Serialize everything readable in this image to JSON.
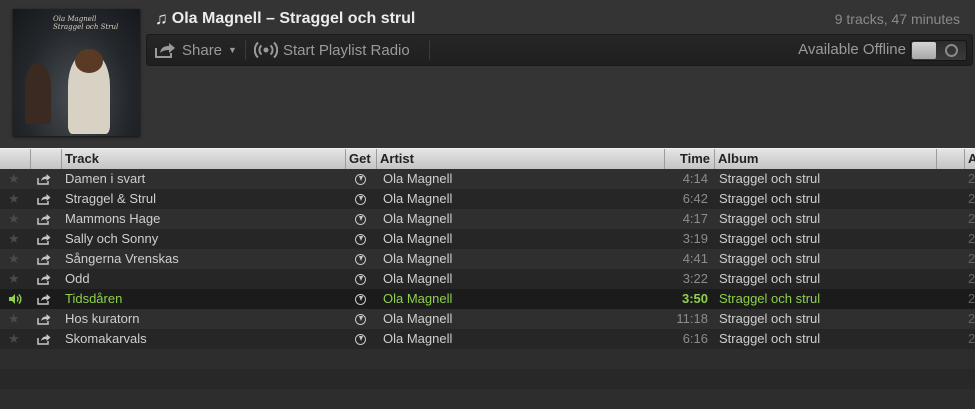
{
  "header": {
    "title": "Ola Magnell – Straggel och strul",
    "meta": "9 tracks, 47 minutes",
    "cover_text_line1": "Ola Magnell",
    "cover_text_line2": "Straggel och Strul"
  },
  "toolbar": {
    "share_label": "Share",
    "radio_label": "Start Playlist Radio",
    "offline_label": "Available Offline"
  },
  "columns": {
    "track": "Track",
    "get": "Get",
    "artist": "Artist",
    "time": "Time",
    "album": "Album",
    "extra": "A"
  },
  "tracks": [
    {
      "title": "Damen i svart",
      "artist": "Ola Magnell",
      "time": "4:14",
      "album": "Straggel och strul",
      "extra": "2"
    },
    {
      "title": "Straggel & Strul",
      "artist": "Ola Magnell",
      "time": "6:42",
      "album": "Straggel och strul",
      "extra": "2"
    },
    {
      "title": "Mammons Hage",
      "artist": "Ola Magnell",
      "time": "4:17",
      "album": "Straggel och strul",
      "extra": "2"
    },
    {
      "title": "Sally och Sonny",
      "artist": "Ola Magnell",
      "time": "3:19",
      "album": "Straggel och strul",
      "extra": "2"
    },
    {
      "title": "Sångerna Vrenskas",
      "artist": "Ola Magnell",
      "time": "4:41",
      "album": "Straggel och strul",
      "extra": "2"
    },
    {
      "title": "Odd",
      "artist": "Ola Magnell",
      "time": "3:22",
      "album": "Straggel och strul",
      "extra": "2"
    },
    {
      "title": "Tidsdåren",
      "artist": "Ola Magnell",
      "time": "3:50",
      "album": "Straggel och strul",
      "extra": "2"
    },
    {
      "title": "Hos kuratorn",
      "artist": "Ola Magnell",
      "time": "11:18",
      "album": "Straggel och strul",
      "extra": "2"
    },
    {
      "title": "Skomakarvals",
      "artist": "Ola Magnell",
      "time": "6:16",
      "album": "Straggel och strul",
      "extra": "2"
    }
  ],
  "colors": {
    "playing": "#8ed04b",
    "background": "#2b2b2b"
  }
}
